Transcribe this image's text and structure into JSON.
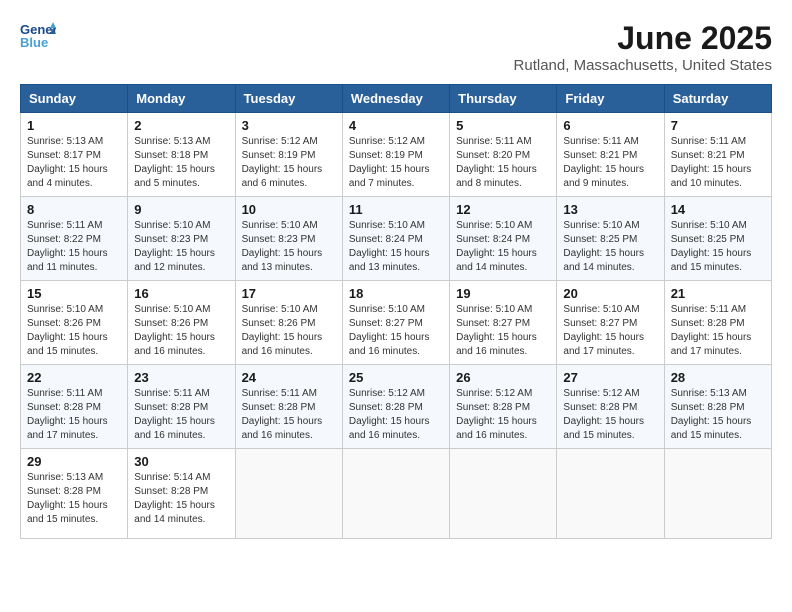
{
  "app": {
    "name_line1": "General",
    "name_line2": "Blue"
  },
  "header": {
    "title": "June 2025",
    "subtitle": "Rutland, Massachusetts, United States"
  },
  "days_of_week": [
    "Sunday",
    "Monday",
    "Tuesday",
    "Wednesday",
    "Thursday",
    "Friday",
    "Saturday"
  ],
  "weeks": [
    [
      {
        "day": "1",
        "sunrise": "5:13 AM",
        "sunset": "8:17 PM",
        "daylight": "15 hours and 4 minutes."
      },
      {
        "day": "2",
        "sunrise": "5:13 AM",
        "sunset": "8:18 PM",
        "daylight": "15 hours and 5 minutes."
      },
      {
        "day": "3",
        "sunrise": "5:12 AM",
        "sunset": "8:19 PM",
        "daylight": "15 hours and 6 minutes."
      },
      {
        "day": "4",
        "sunrise": "5:12 AM",
        "sunset": "8:19 PM",
        "daylight": "15 hours and 7 minutes."
      },
      {
        "day": "5",
        "sunrise": "5:11 AM",
        "sunset": "8:20 PM",
        "daylight": "15 hours and 8 minutes."
      },
      {
        "day": "6",
        "sunrise": "5:11 AM",
        "sunset": "8:21 PM",
        "daylight": "15 hours and 9 minutes."
      },
      {
        "day": "7",
        "sunrise": "5:11 AM",
        "sunset": "8:21 PM",
        "daylight": "15 hours and 10 minutes."
      }
    ],
    [
      {
        "day": "8",
        "sunrise": "5:11 AM",
        "sunset": "8:22 PM",
        "daylight": "15 hours and 11 minutes."
      },
      {
        "day": "9",
        "sunrise": "5:10 AM",
        "sunset": "8:23 PM",
        "daylight": "15 hours and 12 minutes."
      },
      {
        "day": "10",
        "sunrise": "5:10 AM",
        "sunset": "8:23 PM",
        "daylight": "15 hours and 13 minutes."
      },
      {
        "day": "11",
        "sunrise": "5:10 AM",
        "sunset": "8:24 PM",
        "daylight": "15 hours and 13 minutes."
      },
      {
        "day": "12",
        "sunrise": "5:10 AM",
        "sunset": "8:24 PM",
        "daylight": "15 hours and 14 minutes."
      },
      {
        "day": "13",
        "sunrise": "5:10 AM",
        "sunset": "8:25 PM",
        "daylight": "15 hours and 14 minutes."
      },
      {
        "day": "14",
        "sunrise": "5:10 AM",
        "sunset": "8:25 PM",
        "daylight": "15 hours and 15 minutes."
      }
    ],
    [
      {
        "day": "15",
        "sunrise": "5:10 AM",
        "sunset": "8:26 PM",
        "daylight": "15 hours and 15 minutes."
      },
      {
        "day": "16",
        "sunrise": "5:10 AM",
        "sunset": "8:26 PM",
        "daylight": "15 hours and 16 minutes."
      },
      {
        "day": "17",
        "sunrise": "5:10 AM",
        "sunset": "8:26 PM",
        "daylight": "15 hours and 16 minutes."
      },
      {
        "day": "18",
        "sunrise": "5:10 AM",
        "sunset": "8:27 PM",
        "daylight": "15 hours and 16 minutes."
      },
      {
        "day": "19",
        "sunrise": "5:10 AM",
        "sunset": "8:27 PM",
        "daylight": "15 hours and 16 minutes."
      },
      {
        "day": "20",
        "sunrise": "5:10 AM",
        "sunset": "8:27 PM",
        "daylight": "15 hours and 17 minutes."
      },
      {
        "day": "21",
        "sunrise": "5:11 AM",
        "sunset": "8:28 PM",
        "daylight": "15 hours and 17 minutes."
      }
    ],
    [
      {
        "day": "22",
        "sunrise": "5:11 AM",
        "sunset": "8:28 PM",
        "daylight": "15 hours and 17 minutes."
      },
      {
        "day": "23",
        "sunrise": "5:11 AM",
        "sunset": "8:28 PM",
        "daylight": "15 hours and 16 minutes."
      },
      {
        "day": "24",
        "sunrise": "5:11 AM",
        "sunset": "8:28 PM",
        "daylight": "15 hours and 16 minutes."
      },
      {
        "day": "25",
        "sunrise": "5:12 AM",
        "sunset": "8:28 PM",
        "daylight": "15 hours and 16 minutes."
      },
      {
        "day": "26",
        "sunrise": "5:12 AM",
        "sunset": "8:28 PM",
        "daylight": "15 hours and 16 minutes."
      },
      {
        "day": "27",
        "sunrise": "5:12 AM",
        "sunset": "8:28 PM",
        "daylight": "15 hours and 15 minutes."
      },
      {
        "day": "28",
        "sunrise": "5:13 AM",
        "sunset": "8:28 PM",
        "daylight": "15 hours and 15 minutes."
      }
    ],
    [
      {
        "day": "29",
        "sunrise": "5:13 AM",
        "sunset": "8:28 PM",
        "daylight": "15 hours and 15 minutes."
      },
      {
        "day": "30",
        "sunrise": "5:14 AM",
        "sunset": "8:28 PM",
        "daylight": "15 hours and 14 minutes."
      },
      null,
      null,
      null,
      null,
      null
    ]
  ],
  "labels": {
    "sunrise": "Sunrise:",
    "sunset": "Sunset:",
    "daylight": "Daylight:"
  }
}
